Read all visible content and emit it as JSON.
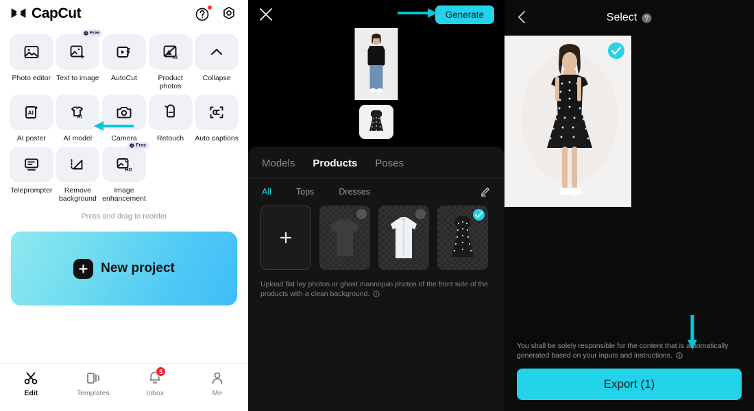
{
  "left_panel": {
    "brand": "CapCut",
    "header_icons": [
      {
        "name": "help-icon",
        "has_dot": true
      },
      {
        "name": "settings-icon",
        "has_dot": false
      }
    ],
    "tools": [
      {
        "label": "Photo editor",
        "icon": "photo-editor-icon",
        "free": false
      },
      {
        "label": "Text to image",
        "icon": "text-to-image-icon",
        "free": true,
        "free_label": "Free"
      },
      {
        "label": "AutoCut",
        "icon": "autocut-icon",
        "free": false
      },
      {
        "label": "Product photos",
        "icon": "product-photos-icon",
        "free": false
      },
      {
        "label": "Collapse",
        "icon": "chevron-up-icon",
        "free": false
      },
      {
        "label": "AI poster",
        "icon": "ai-poster-icon",
        "free": false
      },
      {
        "label": "AI model",
        "icon": "ai-model-icon",
        "free": false
      },
      {
        "label": "Camera",
        "icon": "camera-icon",
        "free": false
      },
      {
        "label": "Retouch",
        "icon": "retouch-icon",
        "free": false
      },
      {
        "label": "Auto captions",
        "icon": "auto-captions-icon",
        "free": false
      },
      {
        "label": "Teleprompter",
        "icon": "teleprompter-icon",
        "free": false
      },
      {
        "label": "Remove background",
        "icon": "remove-background-icon",
        "free": false
      },
      {
        "label": "Image enhancement",
        "icon": "image-enhancement-icon",
        "free": true,
        "free_label": "Free"
      }
    ],
    "reorder_hint": "Press and drag to reorder",
    "new_project_label": "New project",
    "bottom_nav": [
      {
        "label": "Edit",
        "icon": "scissors-icon",
        "active": true,
        "badge": null
      },
      {
        "label": "Templates",
        "icon": "templates-icon",
        "active": false,
        "badge": null
      },
      {
        "label": "Inbox",
        "icon": "bell-icon",
        "active": false,
        "badge": "5"
      },
      {
        "label": "Me",
        "icon": "person-icon",
        "active": false,
        "badge": null
      }
    ]
  },
  "mid_panel": {
    "close_icon": "close-icon",
    "generate_label": "Generate",
    "tabs": [
      {
        "label": "Models",
        "active": false
      },
      {
        "label": "Products",
        "active": true
      },
      {
        "label": "Poses",
        "active": false
      }
    ],
    "sub_tabs": [
      {
        "label": "All",
        "active": true
      },
      {
        "label": "Tops",
        "active": false
      },
      {
        "label": "Dresses",
        "active": false
      }
    ],
    "edit_icon": "pencil-icon",
    "products": [
      {
        "name": "add-product",
        "type": "add",
        "selected": false
      },
      {
        "name": "dark-tshirt",
        "type": "item",
        "selected": false
      },
      {
        "name": "white-shirt",
        "type": "item",
        "selected": false
      },
      {
        "name": "polka-dot-dress",
        "type": "item",
        "selected": true
      }
    ],
    "upload_note": "Upload flat lay photos or ghost manniquin photos of the front side of the products with a clean background.",
    "info_icon": "info-icon"
  },
  "right_panel": {
    "back_icon": "back-chevron-icon",
    "title": "Select",
    "help_icon": "help-icon",
    "result": {
      "name": "generated-model-image",
      "selected": true
    },
    "disclaimer": "You shall be solely responsible for the content that is automatically generated based on your inputs and instructions.",
    "info_icon": "info-icon",
    "export_label": "Export (1)"
  },
  "annotations": {
    "arrow_color": "#00c8dc",
    "arrows": [
      {
        "name": "arrow-to-ai-model",
        "direction": "left",
        "target": "AI model"
      },
      {
        "name": "arrow-to-generate",
        "direction": "right",
        "target": "Generate"
      },
      {
        "name": "arrow-to-export",
        "direction": "down",
        "target": "Export (1)"
      }
    ]
  },
  "colors": {
    "accent_cyan": "#22d3ea",
    "badge_red": "#f5222d",
    "tile_bg": "#f0f1f6",
    "panel_dark": "#141414"
  }
}
